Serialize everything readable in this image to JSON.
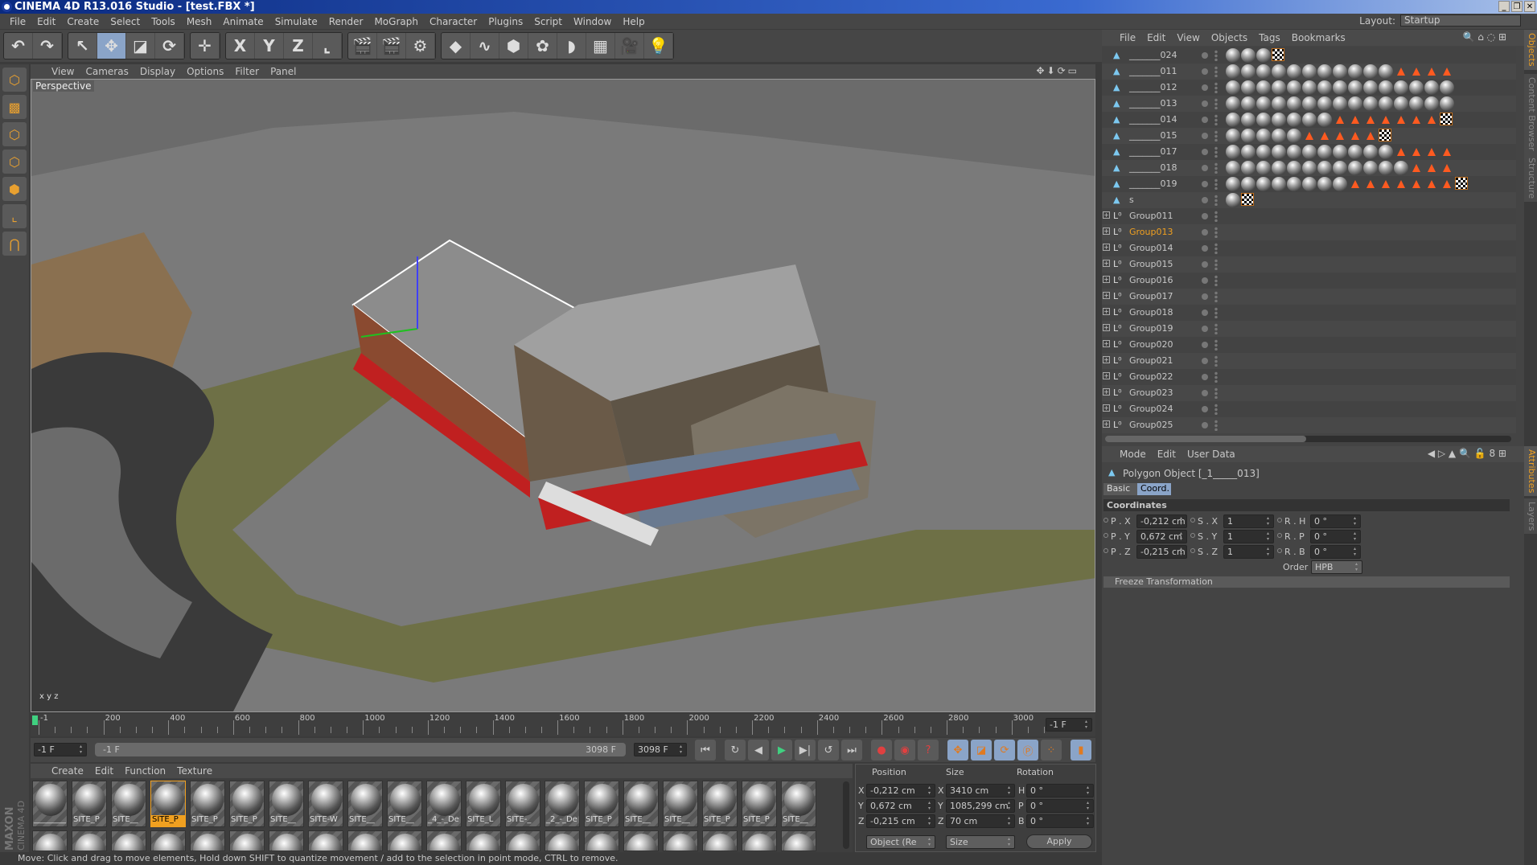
{
  "window": {
    "title": "CINEMA 4D R13.016 Studio - [test.FBX *]",
    "buttons": [
      "_",
      "❐",
      "✕"
    ]
  },
  "menu": [
    "File",
    "Edit",
    "Create",
    "Select",
    "Tools",
    "Mesh",
    "Animate",
    "Simulate",
    "Render",
    "MoGraph",
    "Character",
    "Plugins",
    "Script",
    "Window",
    "Help"
  ],
  "layout": {
    "label": "Layout:",
    "value": "Startup"
  },
  "toolbar": {
    "groups": [
      [
        {
          "icon": "undo-icon",
          "g": "↶"
        },
        {
          "icon": "redo-icon",
          "g": "↷"
        }
      ],
      [
        {
          "icon": "live-selection-icon",
          "g": "↖"
        },
        {
          "icon": "move-icon",
          "g": "✥",
          "on": true
        },
        {
          "icon": "scale-icon",
          "g": "◪"
        },
        {
          "icon": "rotate-icon",
          "g": "⟳"
        }
      ],
      [
        {
          "icon": "recent-tool-icon",
          "g": "✛"
        }
      ],
      [
        {
          "icon": "x-axis-icon",
          "g": "X"
        },
        {
          "icon": "y-axis-icon",
          "g": "Y"
        },
        {
          "icon": "z-axis-icon",
          "g": "Z"
        },
        {
          "icon": "coordinate-system-icon",
          "g": "⌞"
        }
      ],
      [
        {
          "icon": "render-view-icon",
          "g": "🎬"
        },
        {
          "icon": "render-picture-viewer-icon",
          "g": "🎬"
        },
        {
          "icon": "render-settings-icon",
          "g": "⚙"
        }
      ],
      [
        {
          "icon": "cube-icon",
          "g": "◆"
        },
        {
          "icon": "spline-icon",
          "g": "∿"
        },
        {
          "icon": "nurbs-icon",
          "g": "⬢"
        },
        {
          "icon": "array-icon",
          "g": "✿"
        },
        {
          "icon": "deformer-icon",
          "g": "◗"
        },
        {
          "icon": "floor-icon",
          "g": "▦"
        },
        {
          "icon": "camera-icon",
          "g": "🎥"
        },
        {
          "icon": "light-icon",
          "g": "💡"
        }
      ]
    ]
  },
  "left_tools": [
    {
      "icon": "model-mode-icon",
      "g": "⬡"
    },
    {
      "icon": "texture-mode-icon",
      "g": "▩"
    },
    {
      "icon": "points-mode-icon",
      "g": "⬡"
    },
    {
      "icon": "edges-mode-icon",
      "g": "⬡"
    },
    {
      "icon": "polygons-mode-icon",
      "g": "⬢"
    },
    {
      "icon": "axis-mode-icon",
      "g": "⌞"
    },
    {
      "icon": "snap-icon",
      "g": "⋂"
    }
  ],
  "viewport": {
    "menu": [
      "View",
      "Cameras",
      "Display",
      "Options",
      "Filter",
      "Panel"
    ],
    "label": "Perspective",
    "nav_icons": "✥⬇⟳▭"
  },
  "timeline": {
    "ticks": [
      "-1",
      "200",
      "400",
      "600",
      "800",
      "1000",
      "1200",
      "1400",
      "1600",
      "1800",
      "2000",
      "2200",
      "2400",
      "2600",
      "2800",
      "3000"
    ],
    "current": "-1 F"
  },
  "transport": {
    "start": "-1 F",
    "range_start": "-1 F",
    "range_end": "3098 F",
    "end": "3098 F"
  },
  "materials": {
    "menu": [
      "Create",
      "Edit",
      "Function",
      "Texture"
    ],
    "row1": [
      "________",
      "SITE_P",
      "SITE__",
      "SITE_P",
      "SITE_P",
      "SITE_P",
      "SITE__",
      "SITE-W",
      "SITE__",
      "SITE__",
      "_4_-_De",
      "SITE_L",
      "SITE-_",
      "_2_-_De",
      "SITE_P",
      "SITE__",
      "SITE__",
      "SITE_P",
      "SITE_P",
      "SITE__"
    ],
    "selected": 3
  },
  "brand": "MAXON CINEMA 4D",
  "coord_manager": {
    "headers": [
      "Position",
      "Size",
      "Rotation"
    ],
    "rows": [
      {
        "a": "X",
        "p": "-0,212 cm",
        "b": "X",
        "s": "3410 cm",
        "c": "H",
        "r": "0 °"
      },
      {
        "a": "Y",
        "p": "0,672 cm",
        "b": "Y",
        "s": "1085,299 cm",
        "c": "P",
        "r": "0 °"
      },
      {
        "a": "Z",
        "p": "-0,215 cm",
        "b": "Z",
        "s": "70 cm",
        "c": "B",
        "r": "0 °"
      }
    ],
    "mode": "Object (Re",
    "size_mode": "Size",
    "apply": "Apply"
  },
  "status": "Move: Click and drag to move elements, Hold down SHIFT to quantize movement / add to the selection in point mode, CTRL to remove.",
  "object_manager": {
    "menu": [
      "File",
      "Edit",
      "View",
      "Objects",
      "Tags",
      "Bookmarks"
    ],
    "objects": [
      {
        "name": "_______024",
        "type": "polygon",
        "tags": "o,b,f,c"
      },
      {
        "name": "_______011",
        "type": "polygon",
        "tags": "11m,7t"
      },
      {
        "name": "_______012",
        "type": "polygon",
        "tags": "16m,2t"
      },
      {
        "name": "_______013",
        "type": "polygon",
        "tags": "18m"
      },
      {
        "name": "_______014",
        "type": "polygon",
        "tags": "7m,7t,c"
      },
      {
        "name": "_______015",
        "type": "polygon",
        "tags": "5m,5t,c"
      },
      {
        "name": "_______017",
        "type": "polygon",
        "tags": "11m,7t"
      },
      {
        "name": "_______018",
        "type": "polygon",
        "tags": "12m,6t"
      },
      {
        "name": "_______019",
        "type": "polygon",
        "tags": "8m,8t,c"
      },
      {
        "name": "s",
        "type": "polygon",
        "tags": "1m,c"
      },
      {
        "name": "Group011",
        "type": "null"
      },
      {
        "name": "Group013",
        "type": "null",
        "selected": true
      },
      {
        "name": "Group014",
        "type": "null"
      },
      {
        "name": "Group015",
        "type": "null"
      },
      {
        "name": "Group016",
        "type": "null"
      },
      {
        "name": "Group017",
        "type": "null"
      },
      {
        "name": "Group018",
        "type": "null"
      },
      {
        "name": "Group019",
        "type": "null"
      },
      {
        "name": "Group020",
        "type": "null"
      },
      {
        "name": "Group021",
        "type": "null"
      },
      {
        "name": "Group022",
        "type": "null"
      },
      {
        "name": "Group023",
        "type": "null"
      },
      {
        "name": "Group024",
        "type": "null"
      },
      {
        "name": "Group025",
        "type": "null"
      }
    ]
  },
  "attributes": {
    "menu": [
      "Mode",
      "Edit",
      "User Data"
    ],
    "object_title": "Polygon Object [_1_____013]",
    "tabs": [
      "Basic",
      "Coord."
    ],
    "active_tab": "Coord.",
    "section": "Coordinates",
    "fields": [
      [
        {
          "l": "P . X",
          "v": "-0,212 cm"
        },
        {
          "l": "S . X",
          "v": "1"
        },
        {
          "l": "R . H",
          "v": "0 °"
        }
      ],
      [
        {
          "l": "P . Y",
          "v": "0,672 cm"
        },
        {
          "l": "S . Y",
          "v": "1"
        },
        {
          "l": "R . P",
          "v": "0 °"
        }
      ],
      [
        {
          "l": "P . Z",
          "v": "-0,215 cm"
        },
        {
          "l": "S . Z",
          "v": "1"
        },
        {
          "l": "R . B",
          "v": "0 °"
        }
      ]
    ],
    "order_label": "Order",
    "order": "HPB",
    "freeze": "Freeze Transformation"
  },
  "side_tabs": {
    "top": [
      "Objects",
      "Content Browser",
      "Structure"
    ],
    "bottom": [
      "Attributes",
      "Layers"
    ]
  },
  "colors": {
    "accent": "#f0a020",
    "selection_blue": "#8aa4c8",
    "viewport_bg": "#6b6b6b",
    "road_green": "#6e7046"
  }
}
